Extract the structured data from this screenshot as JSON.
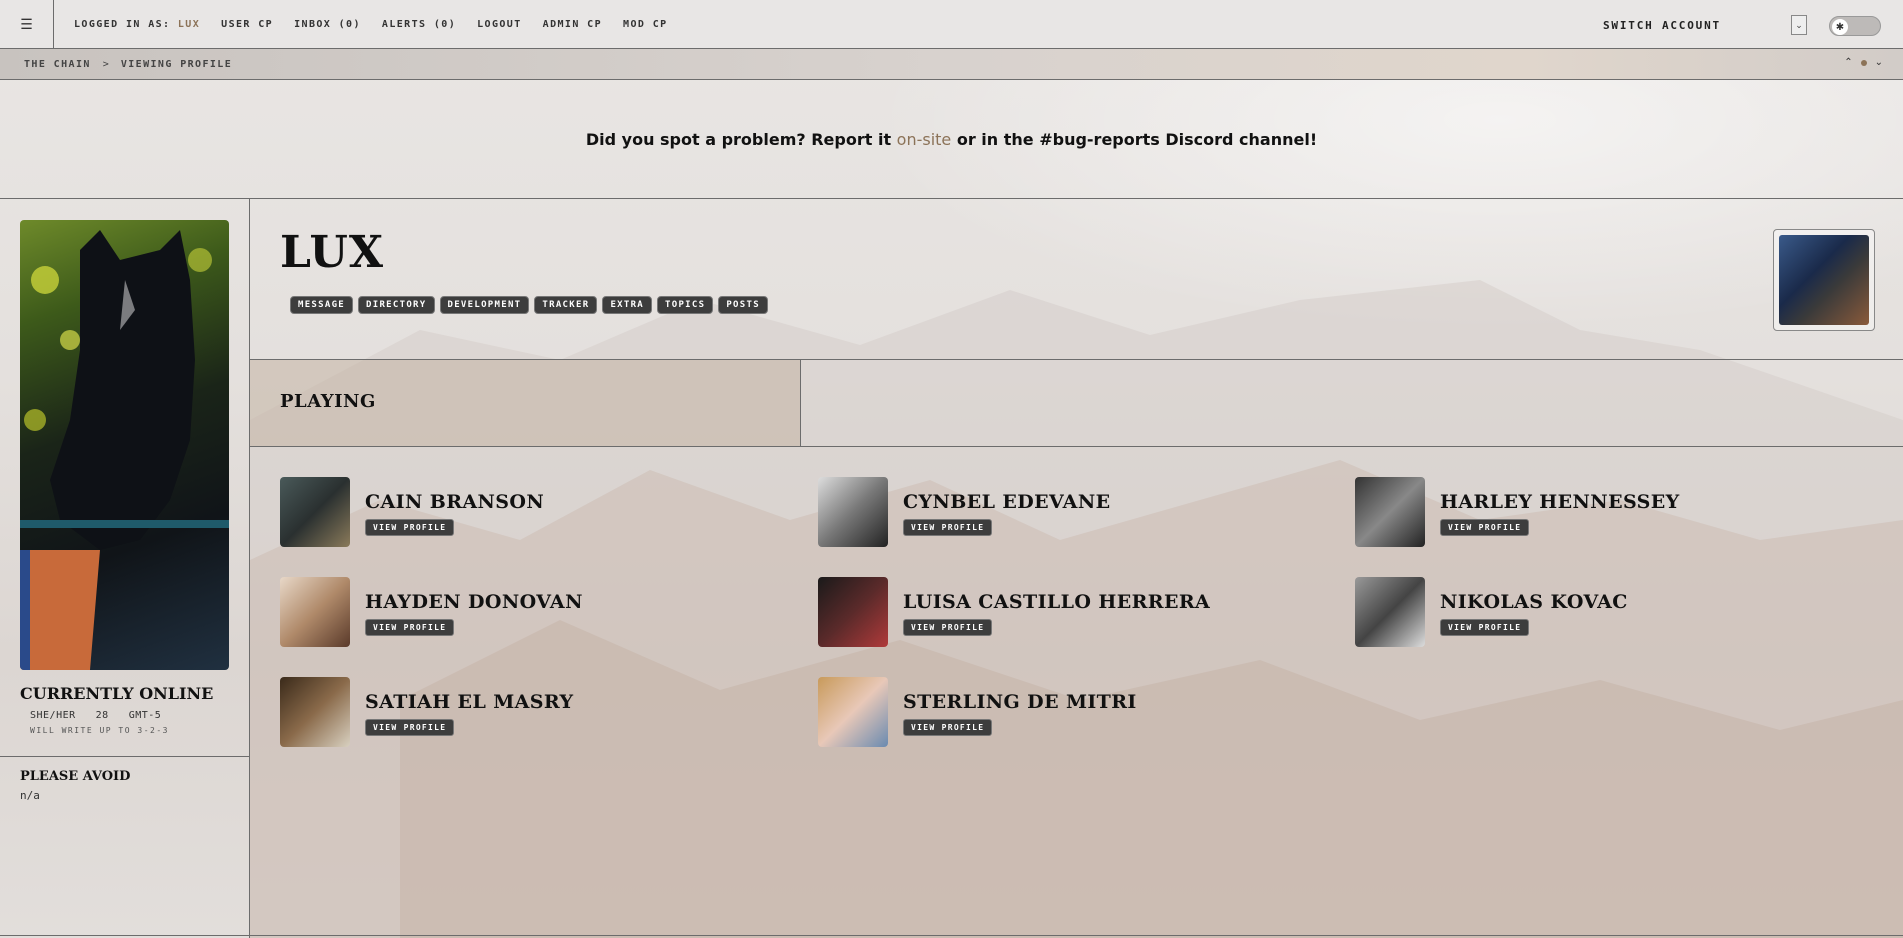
{
  "topbar": {
    "menu_icon": "hamburger-icon",
    "logged_in_prefix": "LOGGED IN AS:",
    "username": "LUX",
    "nav": [
      "USER CP",
      "INBOX (0)",
      "ALERTS (0)",
      "LOGOUT",
      "ADMIN CP",
      "MOD CP"
    ],
    "switch_account": "SWITCH ACCOUNT",
    "dropdown_icon": "chevron-down-icon",
    "toggle_icon": "sun-icon"
  },
  "breadcrumb": {
    "items": [
      "THE CHAIN",
      "VIEWING PROFILE"
    ],
    "separator": ">"
  },
  "announcement": {
    "before": "Did you spot a problem? Report it ",
    "link": "on-site",
    "after": " or in the #bug-reports Discord channel!"
  },
  "sidebar": {
    "status": "CURRENTLY ONLINE",
    "pronouns": "SHE/HER",
    "age": "28",
    "timezone": "GMT-5",
    "writes": "WILL WRITE UP TO 3-2-3",
    "avoid_title": "PLEASE AVOID",
    "avoid_value": "n/a"
  },
  "profile": {
    "name": "LUX",
    "tabs": [
      "MESSAGE",
      "DIRECTORY",
      "DEVELOPMENT",
      "TRACKER",
      "EXTRA",
      "TOPICS",
      "POSTS"
    ]
  },
  "playing": {
    "label": "PLAYING",
    "view_label": "VIEW PROFILE",
    "characters": [
      {
        "name": "CAIN BRANSON"
      },
      {
        "name": "CYNBEL EDEVANE"
      },
      {
        "name": "HARLEY HENNESSEY"
      },
      {
        "name": "HAYDEN DONOVAN"
      },
      {
        "name": "LUISA CASTILLO HERRERA"
      },
      {
        "name": "NIKOLAS KOVAC"
      },
      {
        "name": "SATIAH EL MASRY"
      },
      {
        "name": "STERLING DE MITRI"
      }
    ]
  },
  "colors": {
    "accent": "#8c7358",
    "pill_bg": "#3d3d3d",
    "playing_tab": "#c4b4a4"
  }
}
